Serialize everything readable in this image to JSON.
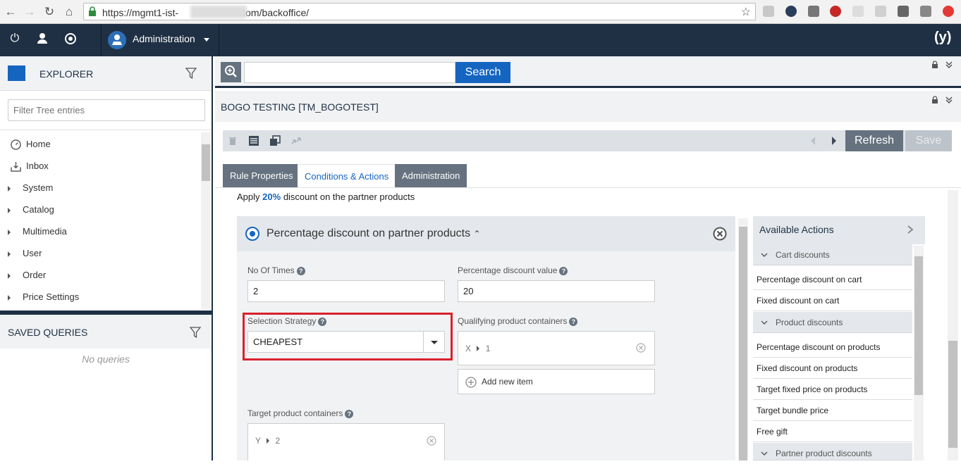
{
  "browser": {
    "url_prefix": "https://mgmt1-ist-",
    "url_suffix": "com/backoffice/"
  },
  "header": {
    "perspective_label": "Administration"
  },
  "explorer": {
    "title": "EXPLORER",
    "filter_placeholder": "Filter Tree entries",
    "items": [
      {
        "label": "Home"
      },
      {
        "label": "Inbox"
      },
      {
        "label": "System"
      },
      {
        "label": "Catalog"
      },
      {
        "label": "Multimedia"
      },
      {
        "label": "User"
      },
      {
        "label": "Order"
      },
      {
        "label": "Price Settings"
      }
    ]
  },
  "saved_queries": {
    "title": "SAVED QUERIES",
    "empty_text": "No queries"
  },
  "search": {
    "button_label": "Search",
    "value": ""
  },
  "editor": {
    "title": "BOGO TESTING [TM_BOGOTEST]",
    "refresh_label": "Refresh",
    "save_label": "Save",
    "tabs": [
      {
        "label": "Rule Properties"
      },
      {
        "label": "Conditions & Actions"
      },
      {
        "label": "Administration"
      }
    ],
    "apply_prefix": "Apply",
    "apply_percent": "20%",
    "apply_suffix": "discount on the partner products"
  },
  "action": {
    "title": "Percentage discount on partner products",
    "fields": {
      "no_of_times_label": "No Of Times",
      "no_of_times_value": "2",
      "pct_label": "Percentage discount value",
      "pct_value": "20",
      "strategy_label": "Selection Strategy",
      "strategy_value": "CHEAPEST",
      "qualifying_label": "Qualifying product containers",
      "qualifying_key": "X",
      "qualifying_val": "1",
      "add_item_label": "Add new item",
      "target_label": "Target product containers",
      "target_key": "Y",
      "target_val": "2"
    }
  },
  "available_actions": {
    "title": "Available Actions",
    "groups": [
      {
        "label": "Cart discounts"
      },
      {
        "label": "Product discounts"
      },
      {
        "label": "Partner product discounts"
      }
    ],
    "items": [
      {
        "label": "Percentage discount on cart"
      },
      {
        "label": "Fixed discount on cart"
      },
      {
        "label": "Percentage discount on products"
      },
      {
        "label": "Fixed discount on products"
      },
      {
        "label": "Target fixed price on products"
      },
      {
        "label": "Target bundle price"
      },
      {
        "label": "Free gift"
      }
    ]
  },
  "colors": {
    "header_bg": "#1f3044",
    "accent": "#1565c0",
    "highlight": "#d9212c"
  }
}
